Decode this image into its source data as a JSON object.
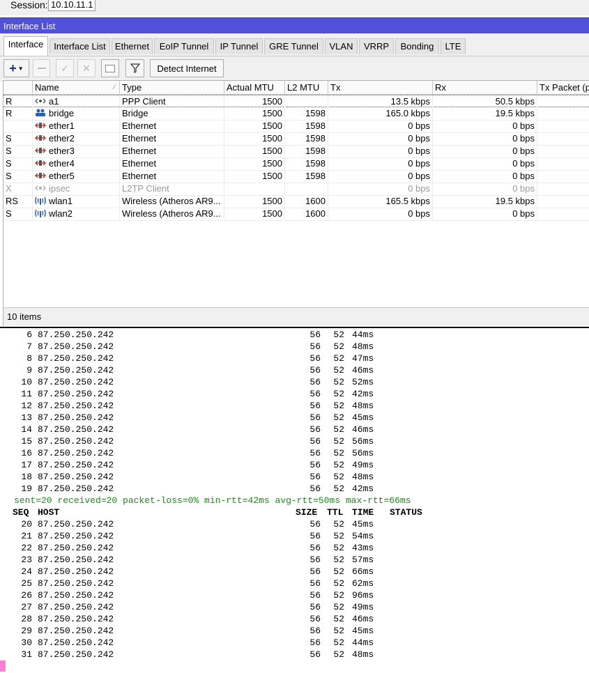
{
  "session": {
    "label": "Session:",
    "value": "10.10.11.1"
  },
  "window": {
    "title": "Interface List"
  },
  "tabs": [
    "Interface",
    "Interface List",
    "Ethernet",
    "EoIP Tunnel",
    "IP Tunnel",
    "GRE Tunnel",
    "VLAN",
    "VRRP",
    "Bonding",
    "LTE"
  ],
  "toolbar": {
    "detect_label": "Detect Internet"
  },
  "table": {
    "columns": [
      "",
      "Name",
      "Type",
      "Actual MTU",
      "L2 MTU",
      "Tx",
      "Rx",
      "Tx Packet (p"
    ],
    "rows": [
      {
        "flag": "R",
        "name": "a1",
        "icon": "ppp-client-icon",
        "type": "PPP Client",
        "mtu": "1500",
        "l2mtu": "",
        "tx": "13.5 kbps",
        "rx": "50.5 kbps",
        "disabled": false,
        "selected": true
      },
      {
        "flag": "R",
        "name": "bridge",
        "icon": "bridge-icon",
        "type": "Bridge",
        "mtu": "1500",
        "l2mtu": "1598",
        "tx": "165.0 kbps",
        "rx": "19.5 kbps",
        "disabled": false,
        "selected": false
      },
      {
        "flag": "",
        "name": "ether1",
        "icon": "ethernet-icon",
        "type": "Ethernet",
        "mtu": "1500",
        "l2mtu": "1598",
        "tx": "0 bps",
        "rx": "0 bps",
        "disabled": false,
        "selected": false
      },
      {
        "flag": "S",
        "name": "ether2",
        "icon": "ethernet-icon",
        "type": "Ethernet",
        "mtu": "1500",
        "l2mtu": "1598",
        "tx": "0 bps",
        "rx": "0 bps",
        "disabled": false,
        "selected": false
      },
      {
        "flag": "S",
        "name": "ether3",
        "icon": "ethernet-icon",
        "type": "Ethernet",
        "mtu": "1500",
        "l2mtu": "1598",
        "tx": "0 bps",
        "rx": "0 bps",
        "disabled": false,
        "selected": false
      },
      {
        "flag": "S",
        "name": "ether4",
        "icon": "ethernet-icon",
        "type": "Ethernet",
        "mtu": "1500",
        "l2mtu": "1598",
        "tx": "0 bps",
        "rx": "0 bps",
        "disabled": false,
        "selected": false
      },
      {
        "flag": "S",
        "name": "ether5",
        "icon": "ethernet-icon",
        "type": "Ethernet",
        "mtu": "1500",
        "l2mtu": "1598",
        "tx": "0 bps",
        "rx": "0 bps",
        "disabled": false,
        "selected": false
      },
      {
        "flag": "X",
        "name": "ipsec",
        "icon": "l2tp-client-icon",
        "type": "L2TP Client",
        "mtu": "",
        "l2mtu": "",
        "tx": "0 bps",
        "rx": "0 bps",
        "disabled": true,
        "selected": false
      },
      {
        "flag": "RS",
        "name": "wlan1",
        "icon": "wireless-icon",
        "type": "Wireless (Atheros AR9...",
        "mtu": "1500",
        "l2mtu": "1600",
        "tx": "165.5 kbps",
        "rx": "19.5 kbps",
        "disabled": false,
        "selected": false
      },
      {
        "flag": "S",
        "name": "wlan2",
        "icon": "wireless-icon",
        "type": "Wireless (Atheros AR9...",
        "mtu": "1500",
        "l2mtu": "1600",
        "tx": "0 bps",
        "rx": "0 bps",
        "disabled": false,
        "selected": false
      }
    ]
  },
  "status": {
    "count": "10 items"
  },
  "terminal": {
    "lines_a": [
      {
        "seq": "6",
        "host": "87.250.250.242",
        "size": "56",
        "ttl": "52",
        "time": "44ms"
      },
      {
        "seq": "7",
        "host": "87.250.250.242",
        "size": "56",
        "ttl": "52",
        "time": "48ms"
      },
      {
        "seq": "8",
        "host": "87.250.250.242",
        "size": "56",
        "ttl": "52",
        "time": "47ms"
      },
      {
        "seq": "9",
        "host": "87.250.250.242",
        "size": "56",
        "ttl": "52",
        "time": "46ms"
      },
      {
        "seq": "10",
        "host": "87.250.250.242",
        "size": "56",
        "ttl": "52",
        "time": "52ms"
      },
      {
        "seq": "11",
        "host": "87.250.250.242",
        "size": "56",
        "ttl": "52",
        "time": "42ms"
      },
      {
        "seq": "12",
        "host": "87.250.250.242",
        "size": "56",
        "ttl": "52",
        "time": "48ms"
      },
      {
        "seq": "13",
        "host": "87.250.250.242",
        "size": "56",
        "ttl": "52",
        "time": "45ms"
      },
      {
        "seq": "14",
        "host": "87.250.250.242",
        "size": "56",
        "ttl": "52",
        "time": "46ms"
      },
      {
        "seq": "15",
        "host": "87.250.250.242",
        "size": "56",
        "ttl": "52",
        "time": "56ms"
      },
      {
        "seq": "16",
        "host": "87.250.250.242",
        "size": "56",
        "ttl": "52",
        "time": "56ms"
      },
      {
        "seq": "17",
        "host": "87.250.250.242",
        "size": "56",
        "ttl": "52",
        "time": "49ms"
      },
      {
        "seq": "18",
        "host": "87.250.250.242",
        "size": "56",
        "ttl": "52",
        "time": "48ms"
      },
      {
        "seq": "19",
        "host": "87.250.250.242",
        "size": "56",
        "ttl": "52",
        "time": "42ms"
      }
    ],
    "summary": "  sent=20 received=20 packet-loss=0% min-rtt=42ms avg-rtt=50ms max-rtt=66ms",
    "header": {
      "seq": "SEQ",
      "host": "HOST",
      "size": "SIZE",
      "ttl": "TTL",
      "time": "TIME",
      "status": "STATUS"
    },
    "lines_b": [
      {
        "seq": "20",
        "host": "87.250.250.242",
        "size": "56",
        "ttl": "52",
        "time": "45ms"
      },
      {
        "seq": "21",
        "host": "87.250.250.242",
        "size": "56",
        "ttl": "52",
        "time": "54ms"
      },
      {
        "seq": "22",
        "host": "87.250.250.242",
        "size": "56",
        "ttl": "52",
        "time": "43ms"
      },
      {
        "seq": "23",
        "host": "87.250.250.242",
        "size": "56",
        "ttl": "52",
        "time": "57ms"
      },
      {
        "seq": "24",
        "host": "87.250.250.242",
        "size": "56",
        "ttl": "52",
        "time": "66ms"
      },
      {
        "seq": "25",
        "host": "87.250.250.242",
        "size": "56",
        "ttl": "52",
        "time": "62ms"
      },
      {
        "seq": "26",
        "host": "87.250.250.242",
        "size": "56",
        "ttl": "52",
        "time": "96ms"
      },
      {
        "seq": "27",
        "host": "87.250.250.242",
        "size": "56",
        "ttl": "52",
        "time": "49ms"
      },
      {
        "seq": "28",
        "host": "87.250.250.242",
        "size": "56",
        "ttl": "52",
        "time": "46ms"
      },
      {
        "seq": "29",
        "host": "87.250.250.242",
        "size": "56",
        "ttl": "52",
        "time": "45ms"
      },
      {
        "seq": "30",
        "host": "87.250.250.242",
        "size": "56",
        "ttl": "52",
        "time": "44ms"
      },
      {
        "seq": "31",
        "host": "87.250.250.242",
        "size": "56",
        "ttl": "52",
        "time": "48ms"
      }
    ]
  },
  "colors": {
    "title_bar": "#5050d8",
    "summary_text": "#1a8f1a",
    "cursor": "#ff7fd6"
  }
}
